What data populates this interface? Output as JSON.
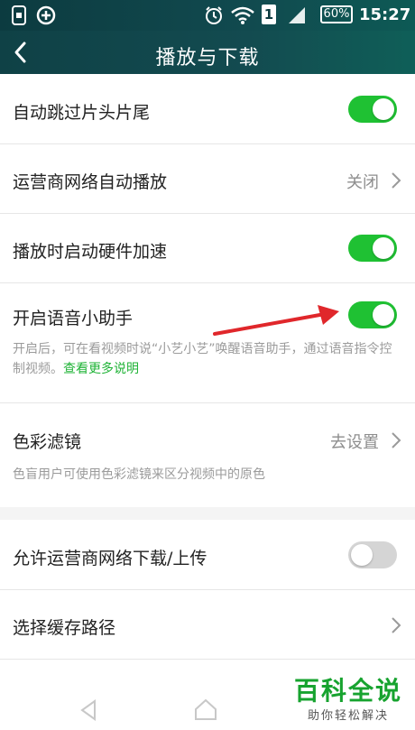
{
  "status_bar": {
    "icons": [
      "sim-icon",
      "plus-circle-icon",
      "alarm-icon",
      "wifi-icon",
      "sim1-icon",
      "signal-icon",
      "battery-icon"
    ],
    "sim_number": "1",
    "battery": "60%",
    "time": "15:27"
  },
  "header": {
    "title": "播放与下载"
  },
  "settings": {
    "skip_intro": {
      "label": "自动跳过片头片尾",
      "enabled": true
    },
    "carrier_autoplay": {
      "label": "运营商网络自动播放",
      "value": "关闭"
    },
    "hw_accel": {
      "label": "播放时启动硬件加速",
      "enabled": true
    },
    "voice_assistant": {
      "label": "开启语音小助手",
      "enabled": true,
      "desc": "开启后，可在看视频时说“小艺小艺”唤醒语音助手，通过语音指令控制视频。",
      "link": "查看更多说明"
    },
    "color_filter": {
      "label": "色彩滤镜",
      "value": "去设置",
      "desc": "色盲用户可使用色彩滤镜来区分视频中的原色"
    },
    "carrier_download": {
      "label": "允许运营商网络下载/上传",
      "enabled": false
    },
    "cache_path": {
      "label": "选择缓存路径"
    }
  },
  "watermark": {
    "title": "百科全说",
    "subtitle": "助你轻松解决"
  },
  "colors": {
    "accent_green": "#1fc133",
    "annotation_red": "#e0272b",
    "header_bg": "#114a4f"
  }
}
